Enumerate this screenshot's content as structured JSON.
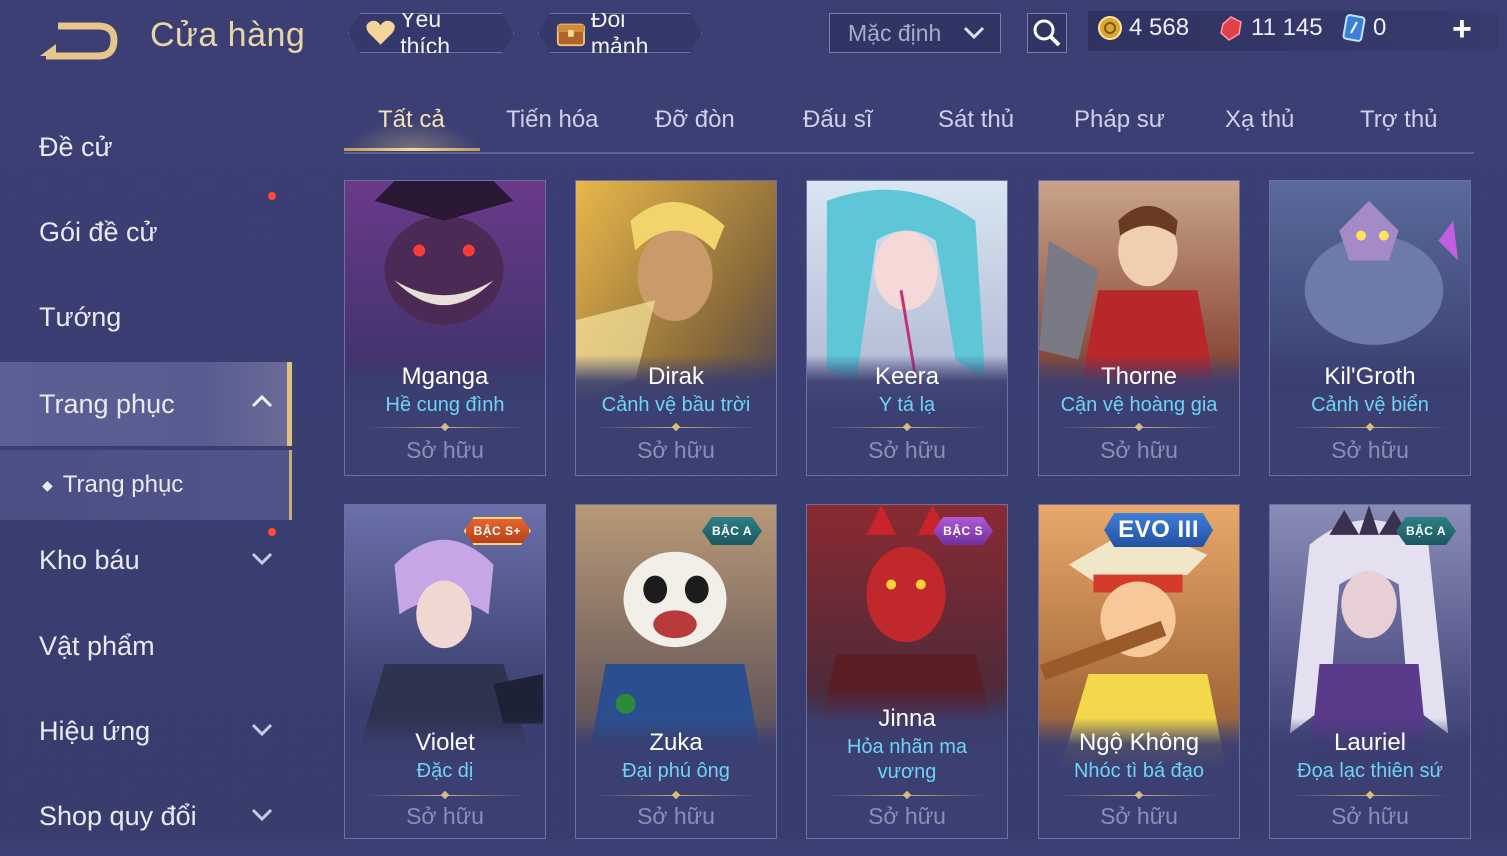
{
  "header": {
    "title": "Cửa hàng",
    "favorites_label": "Yêu thích",
    "shard_exchange_label": "Đổi mảnh",
    "sort_value": "Mặc định"
  },
  "currencies": {
    "gold": "4 568",
    "gems": "11 145",
    "tickets": "0"
  },
  "sidebar": {
    "items": [
      {
        "label": "Đề cử"
      },
      {
        "label": "Gói đề cử"
      },
      {
        "label": "Tướng"
      },
      {
        "label": "Trang phục"
      },
      {
        "label": "Kho báu"
      },
      {
        "label": "Vật phẩm"
      },
      {
        "label": "Hiệu ứng"
      },
      {
        "label": "Shop quy đổi"
      }
    ],
    "sub_item": "Trang phục"
  },
  "tabs": [
    "Tất cả",
    "Tiến hóa",
    "Đỡ đòn",
    "Đấu sĩ",
    "Sát thủ",
    "Pháp sư",
    "Xạ thủ",
    "Trợ thủ"
  ],
  "cards": [
    {
      "hero": "Mganga",
      "skin": "Hề cung đình",
      "status": "Sở hữu"
    },
    {
      "hero": "Dirak",
      "skin": "Cảnh vệ bầu trời",
      "status": "Sở hữu"
    },
    {
      "hero": "Keera",
      "skin": "Y tá lạ",
      "status": "Sở hữu"
    },
    {
      "hero": "Thorne",
      "skin": "Cận vệ hoàng gia",
      "status": "Sở hữu"
    },
    {
      "hero": "Kil'Groth",
      "skin": "Cảnh vệ biển",
      "status": "Sở hữu"
    },
    {
      "hero": "Violet",
      "skin": "Đặc dị",
      "status": "Sở hữu",
      "badge": "BẬC S+"
    },
    {
      "hero": "Zuka",
      "skin": "Đại phú ông",
      "status": "Sở hữu",
      "badge": "BẬC A"
    },
    {
      "hero": "Jinna",
      "skin": "Hỏa nhãn ma vương",
      "status": "Sở hữu",
      "badge": "BẬC S"
    },
    {
      "hero": "Ngộ Không",
      "skin": "Nhóc tì bá đạo",
      "status": "Sở hữu",
      "badge": "EVO III"
    },
    {
      "hero": "Lauriel",
      "skin": "Đọa lạc thiên sứ",
      "status": "Sở hữu",
      "badge": "BẬC A"
    }
  ],
  "colors": {
    "background": "#3a3e72",
    "accent_gold": "#e9d6a7",
    "skin_name": "#6fd3f5",
    "notification": "#ff4b3a"
  }
}
